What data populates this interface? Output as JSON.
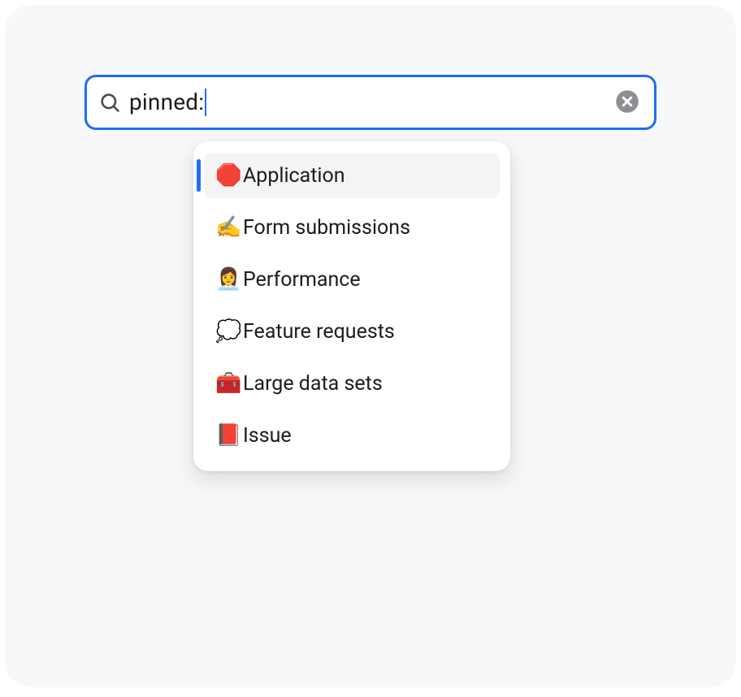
{
  "search": {
    "value": "pinned:",
    "placeholder": ""
  },
  "colors": {
    "accent": "#1d6ff2",
    "panel": "#f7f8fa"
  },
  "suggestions": [
    {
      "emoji": "🛑",
      "label": "Application",
      "selected": true
    },
    {
      "emoji": "✍️",
      "label": "Form submissions",
      "selected": false
    },
    {
      "emoji": "👩‍💼",
      "label": "Performance",
      "selected": false
    },
    {
      "emoji": "💭",
      "label": "Feature requests",
      "selected": false
    },
    {
      "emoji": "🧰",
      "label": "Large data sets",
      "selected": false
    },
    {
      "emoji": "📕",
      "label": "Issue",
      "selected": false
    }
  ]
}
